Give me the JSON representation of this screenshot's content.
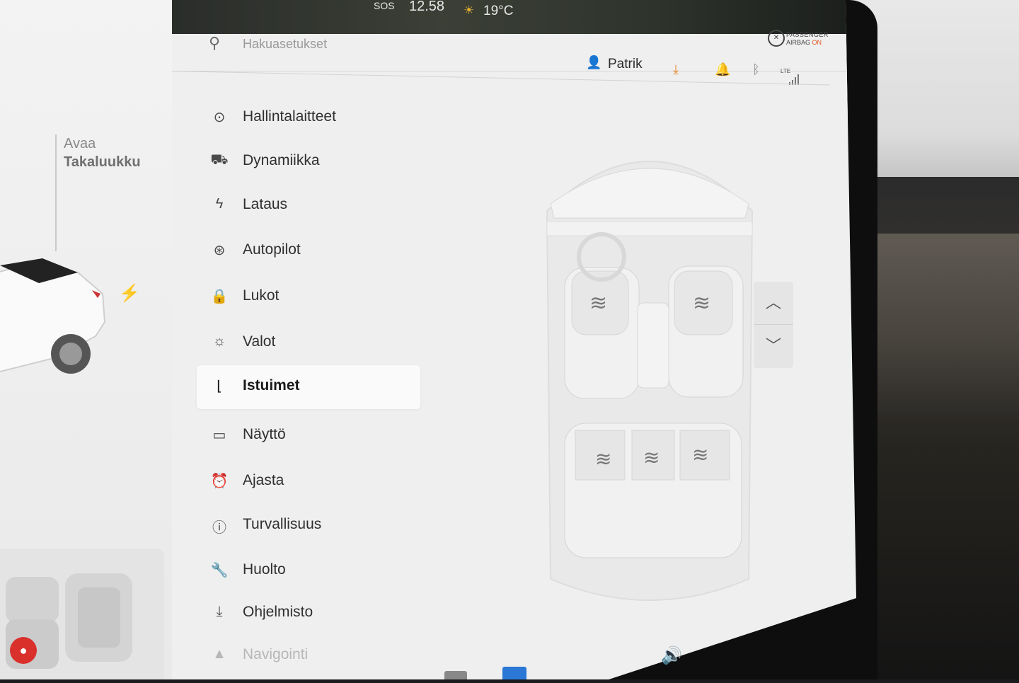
{
  "status_bar": {
    "sos": "SOS",
    "time": "12.58",
    "temperature": "19°C",
    "airbag_line1": "PASSENGER",
    "airbag_line2": "AIRBAG",
    "airbag_state": "ON"
  },
  "left_panel": {
    "trunk_action": "Avaa",
    "trunk_name": "Takaluukku"
  },
  "search": {
    "placeholder": "Hakuasetukset"
  },
  "header": {
    "user_name": "Patrik",
    "network": "LTE"
  },
  "menu": {
    "items": [
      {
        "label": "Hallintalaitteet",
        "icon": "toggle-icon"
      },
      {
        "label": "Dynamiikka",
        "icon": "car-icon"
      },
      {
        "label": "Lataus",
        "icon": "bolt-icon"
      },
      {
        "label": "Autopilot",
        "icon": "steering-wheel-icon"
      },
      {
        "label": "Lukot",
        "icon": "lock-icon"
      },
      {
        "label": "Valot",
        "icon": "light-icon"
      },
      {
        "label": "Istuimet",
        "icon": "seat-icon",
        "active": true
      },
      {
        "label": "Näyttö",
        "icon": "display-icon"
      },
      {
        "label": "Ajasta",
        "icon": "alarm-clock-icon"
      },
      {
        "label": "Turvallisuus",
        "icon": "safety-icon"
      },
      {
        "label": "Huolto",
        "icon": "wrench-icon"
      },
      {
        "label": "Ohjelmisto",
        "icon": "download-icon"
      },
      {
        "label": "Navigointi",
        "icon": "navigation-icon"
      }
    ]
  },
  "seat_heaters": {
    "glyph": "≋",
    "seats": [
      "driver",
      "passenger",
      "rear-left",
      "rear-center",
      "rear-right"
    ]
  }
}
